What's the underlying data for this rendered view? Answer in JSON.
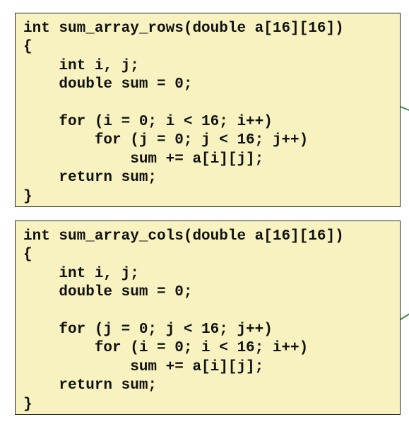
{
  "code_blocks": [
    {
      "lines": [
        "int sum_array_rows(double a[16][16])",
        "{",
        "    int i, j;",
        "    double sum = 0;",
        "",
        "    for (i = 0; i < 16; i++)",
        "        for (j = 0; j < 16; j++)",
        "            sum += a[i][j];",
        "    return sum;",
        "}"
      ]
    },
    {
      "lines": [
        "int sum_array_cols(double a[16][16])",
        "{",
        "    int i, j;",
        "    double sum = 0;",
        "",
        "    for (j = 0; j < 16; j++)",
        "        for (i = 0; i < 16; i++)",
        "            sum += a[i][j];",
        "    return sum;",
        "}"
      ]
    }
  ],
  "colors": {
    "box_background": "#f7f2bf",
    "box_border": "#2a2a2a",
    "text": "#111111",
    "connector": "#3e8a3e"
  }
}
